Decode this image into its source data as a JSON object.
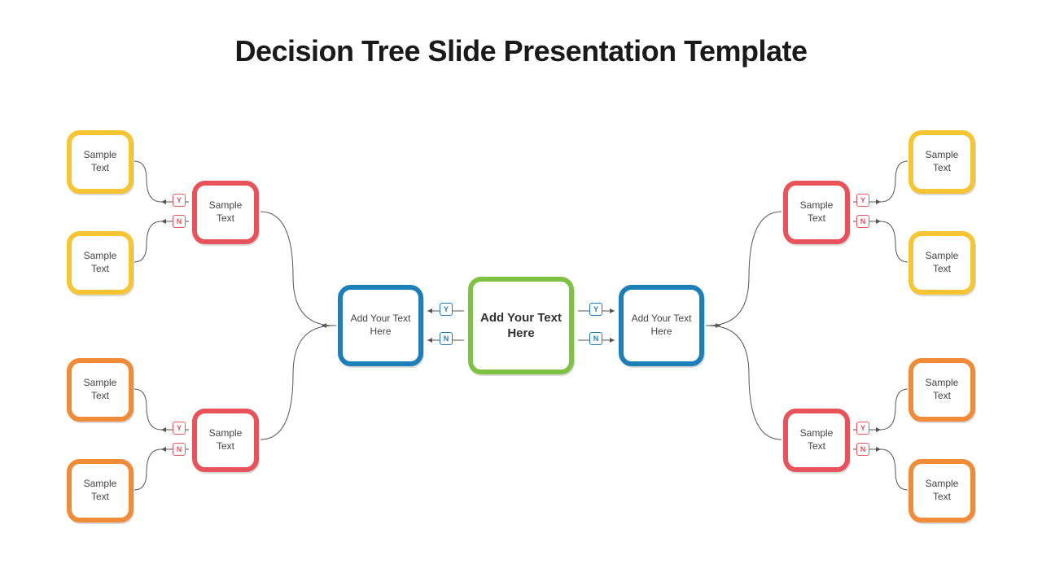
{
  "title": "Decision Tree Slide Presentation Template",
  "labels": {
    "yes": "Y",
    "no": "N"
  },
  "nodes": {
    "center": "Add Your Text Here",
    "blue_left": "Add Your Text Here",
    "blue_right": "Add Your Text Here",
    "red_tl": "Sample Text",
    "red_bl": "Sample Text",
    "red_tr": "Sample Text",
    "red_br": "Sample Text",
    "yellow_tl1": "Sample Text",
    "yellow_tl2": "Sample Text",
    "yellow_tr1": "Sample Text",
    "yellow_tr2": "Sample Text",
    "orange_bl1": "Sample Text",
    "orange_bl2": "Sample Text",
    "orange_br1": "Sample Text",
    "orange_br2": "Sample Text"
  },
  "colors": {
    "green": "#7fc142",
    "blue": "#1d7fb8",
    "red": "#e8525b",
    "yellow": "#f5c534",
    "orange": "#f08b3a"
  }
}
